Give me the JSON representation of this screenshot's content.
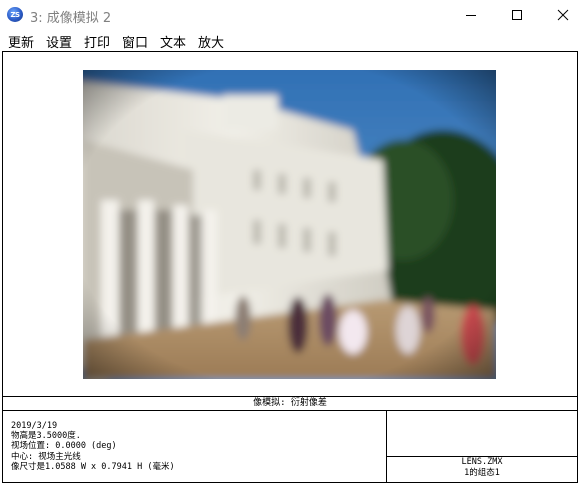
{
  "window": {
    "title": "3: 成像模拟 2",
    "app_icon_label": "ZS",
    "app_icon": "zemax-app-icon",
    "controls": [
      "minimize-icon",
      "maximize-icon",
      "close-icon"
    ]
  },
  "menu": {
    "items": [
      {
        "label": "更新"
      },
      {
        "label": "设置"
      },
      {
        "label": "打印"
      },
      {
        "label": "窗口"
      },
      {
        "label": "文本"
      },
      {
        "label": "放大"
      }
    ]
  },
  "graphic": {
    "image_description_icon": "blurred-building-photo",
    "caption": "像模拟: 衍射像差",
    "info_lines": [
      "2019/3/19",
      "物高是3.5000度.",
      "视场位置: 0.0000 (deg)",
      "中心: 视场主光线",
      "像尺寸是1.0588 W x 0.7941 H (毫米)"
    ],
    "lens_file": "LENS.ZMX",
    "config": "1的组态1"
  },
  "colors": {
    "title_text": "#808080",
    "border": "#000000",
    "background": "#ffffff"
  }
}
